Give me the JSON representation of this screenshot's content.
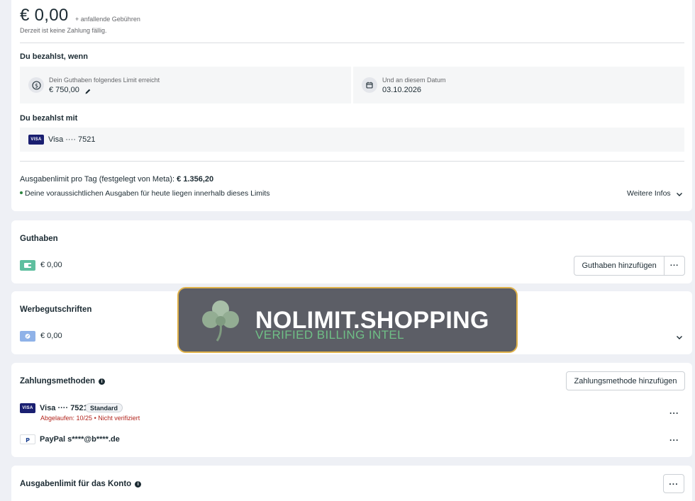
{
  "summary": {
    "amount": "€ 0,00",
    "fees_note": "+ anfallende Gebühren",
    "status": "Derzeit ist keine Zahlung fällig.",
    "pay_when_title": "Du bezahlst, wenn",
    "limit_label": "Dein Guthaben folgendes Limit erreicht",
    "limit_value": "€ 750,00",
    "date_label": "Und an diesem Datum",
    "date_value": "03.10.2026",
    "pay_with_title": "Du bezahlst mit",
    "pay_with_card": "Visa ···· 7521",
    "visa_logo": "VISA",
    "daily_limit_label": "Ausgabenlimit pro Tag (festgelegt von Meta):",
    "daily_limit_value": "€ 1.356,20",
    "daily_limit_note": "Deine voraussichtlichen Ausgaben für heute liegen innerhalb dieses Limits",
    "more_info": "Weitere Infos"
  },
  "guthaben": {
    "title": "Guthaben",
    "amount": "€ 0,00",
    "add_button": "Guthaben hinzufügen",
    "more_button": "···"
  },
  "credits": {
    "title": "Werbegutschriften",
    "amount": "€ 0,00"
  },
  "payment_methods": {
    "title": "Zahlungsmethoden",
    "add_button": "Zahlungsmethode hinzufügen",
    "items": [
      {
        "logo": "VISA",
        "name": "Visa ···· 7521",
        "badge": "Standard",
        "status": "Abgelaufen: 10/25 • Nicht verifiziert",
        "more": "···"
      },
      {
        "logo": "PayPal",
        "name": "PayPal s****@b****.de",
        "more": "···"
      }
    ]
  },
  "account_limit": {
    "title": "Ausgabenlimit für das Konto",
    "more_button": "···"
  },
  "watermark": {
    "title": "NOLIMIT.SHOPPING",
    "subtitle": "VERIFIED BILLING INTEL"
  },
  "colors": {
    "accent_text": "#1c2b33",
    "error": "#b3261e",
    "wallet_green": "#5fbf9f",
    "credit_blue": "#8fb2e8",
    "visa_blue": "#1a1f71",
    "watermark_border": "#e0b24a",
    "watermark_sub": "#6fbf86"
  },
  "icons": [
    "dollar-circle-icon",
    "pencil-icon",
    "calendar-icon",
    "wallet-icon",
    "coupon-icon",
    "chevron-down-icon",
    "info-icon",
    "clover-icon",
    "paypal-icon"
  ]
}
